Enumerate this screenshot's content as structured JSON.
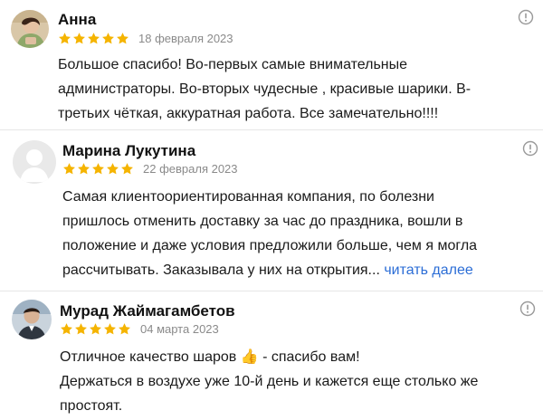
{
  "reviews": [
    {
      "name": "Анна",
      "rating": 5,
      "date": "18 февраля 2023",
      "lines": [
        "Большое спасибо! Во-первых самые внимательные",
        "администраторы. Во-вторых чудесные , красивые шарики. В-",
        "третьих чёткая, аккуратная работа. Все замечательно!!!!"
      ]
    },
    {
      "name": "Марина Лукутина",
      "rating": 5,
      "date": "22 февраля 2023",
      "lines": [
        "Самая клиентоориентированная компания, по болезни",
        "пришлось отменить доставку за час до праздника, вошли в",
        "положение и даже условия предложили больше, чем я могла",
        "рассчитывать. Заказывала у них на открытия..."
      ],
      "more_label": "читать далее"
    },
    {
      "name": "Мурад Жаймагамбетов",
      "rating": 5,
      "date": "04 марта 2023",
      "line1_before_emoji": "Отличное качество шаров",
      "emoji": "👍",
      "line1_after_emoji": " - спасибо вам!",
      "lines_rest": [
        "Держаться в воздухе уже 10-й день и кажется еще столько же",
        "простоят."
      ]
    }
  ],
  "colors": {
    "star": "#f5b400",
    "link": "#2b6dd6",
    "date": "#8a8a8a"
  },
  "icons": {
    "rating": "star-icon",
    "report": "info-icon"
  }
}
